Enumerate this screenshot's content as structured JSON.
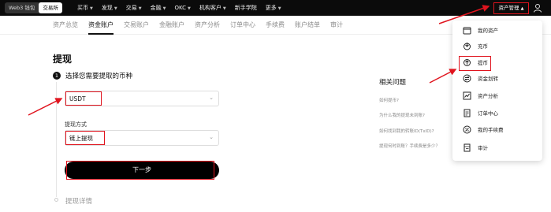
{
  "topnav": {
    "pills": [
      "Web3 钱包",
      "交易所"
    ],
    "menu": [
      "买币",
      "发现",
      "交易",
      "金融",
      "OKC",
      "机构客户",
      "新手学院",
      "更多"
    ],
    "asset_management": "资产管理"
  },
  "subnav": {
    "items": [
      "资产总览",
      "资金账户",
      "交易账户",
      "金融账户",
      "资产分析",
      "订单中心",
      "手续费",
      "账户结单",
      "审计"
    ],
    "active": "资金账户"
  },
  "main": {
    "title": "提现",
    "step1_number": "1",
    "step1_title": "选择您需要提取的币种",
    "coin_value": "USDT",
    "method_label": "提现方式",
    "method_value": "链上提现",
    "next_button": "下一步",
    "step2_title": "提现详情"
  },
  "faq": {
    "title": "相关问题",
    "links": [
      "如何提币?",
      "为什么我的提现未到账?",
      "如何找到我的转账ID(TxID)?",
      "提现何时到账？手续费是多少？"
    ]
  },
  "dropdown": {
    "items": [
      {
        "label": "我的资产",
        "icon": "wallet-icon"
      },
      {
        "label": "充币",
        "icon": "deposit-icon"
      },
      {
        "label": "提币",
        "icon": "withdraw-icon"
      },
      {
        "label": "资金划转",
        "icon": "transfer-icon"
      },
      {
        "label": "资产分析",
        "icon": "analysis-icon"
      },
      {
        "label": "订单中心",
        "icon": "order-icon"
      },
      {
        "label": "我的手续费",
        "icon": "fee-icon"
      },
      {
        "label": "审计",
        "icon": "audit-icon"
      }
    ]
  },
  "colors": {
    "annotation_red": "#e0141e",
    "nav_bg": "#0b0b0b",
    "primary_button": "#000000"
  }
}
